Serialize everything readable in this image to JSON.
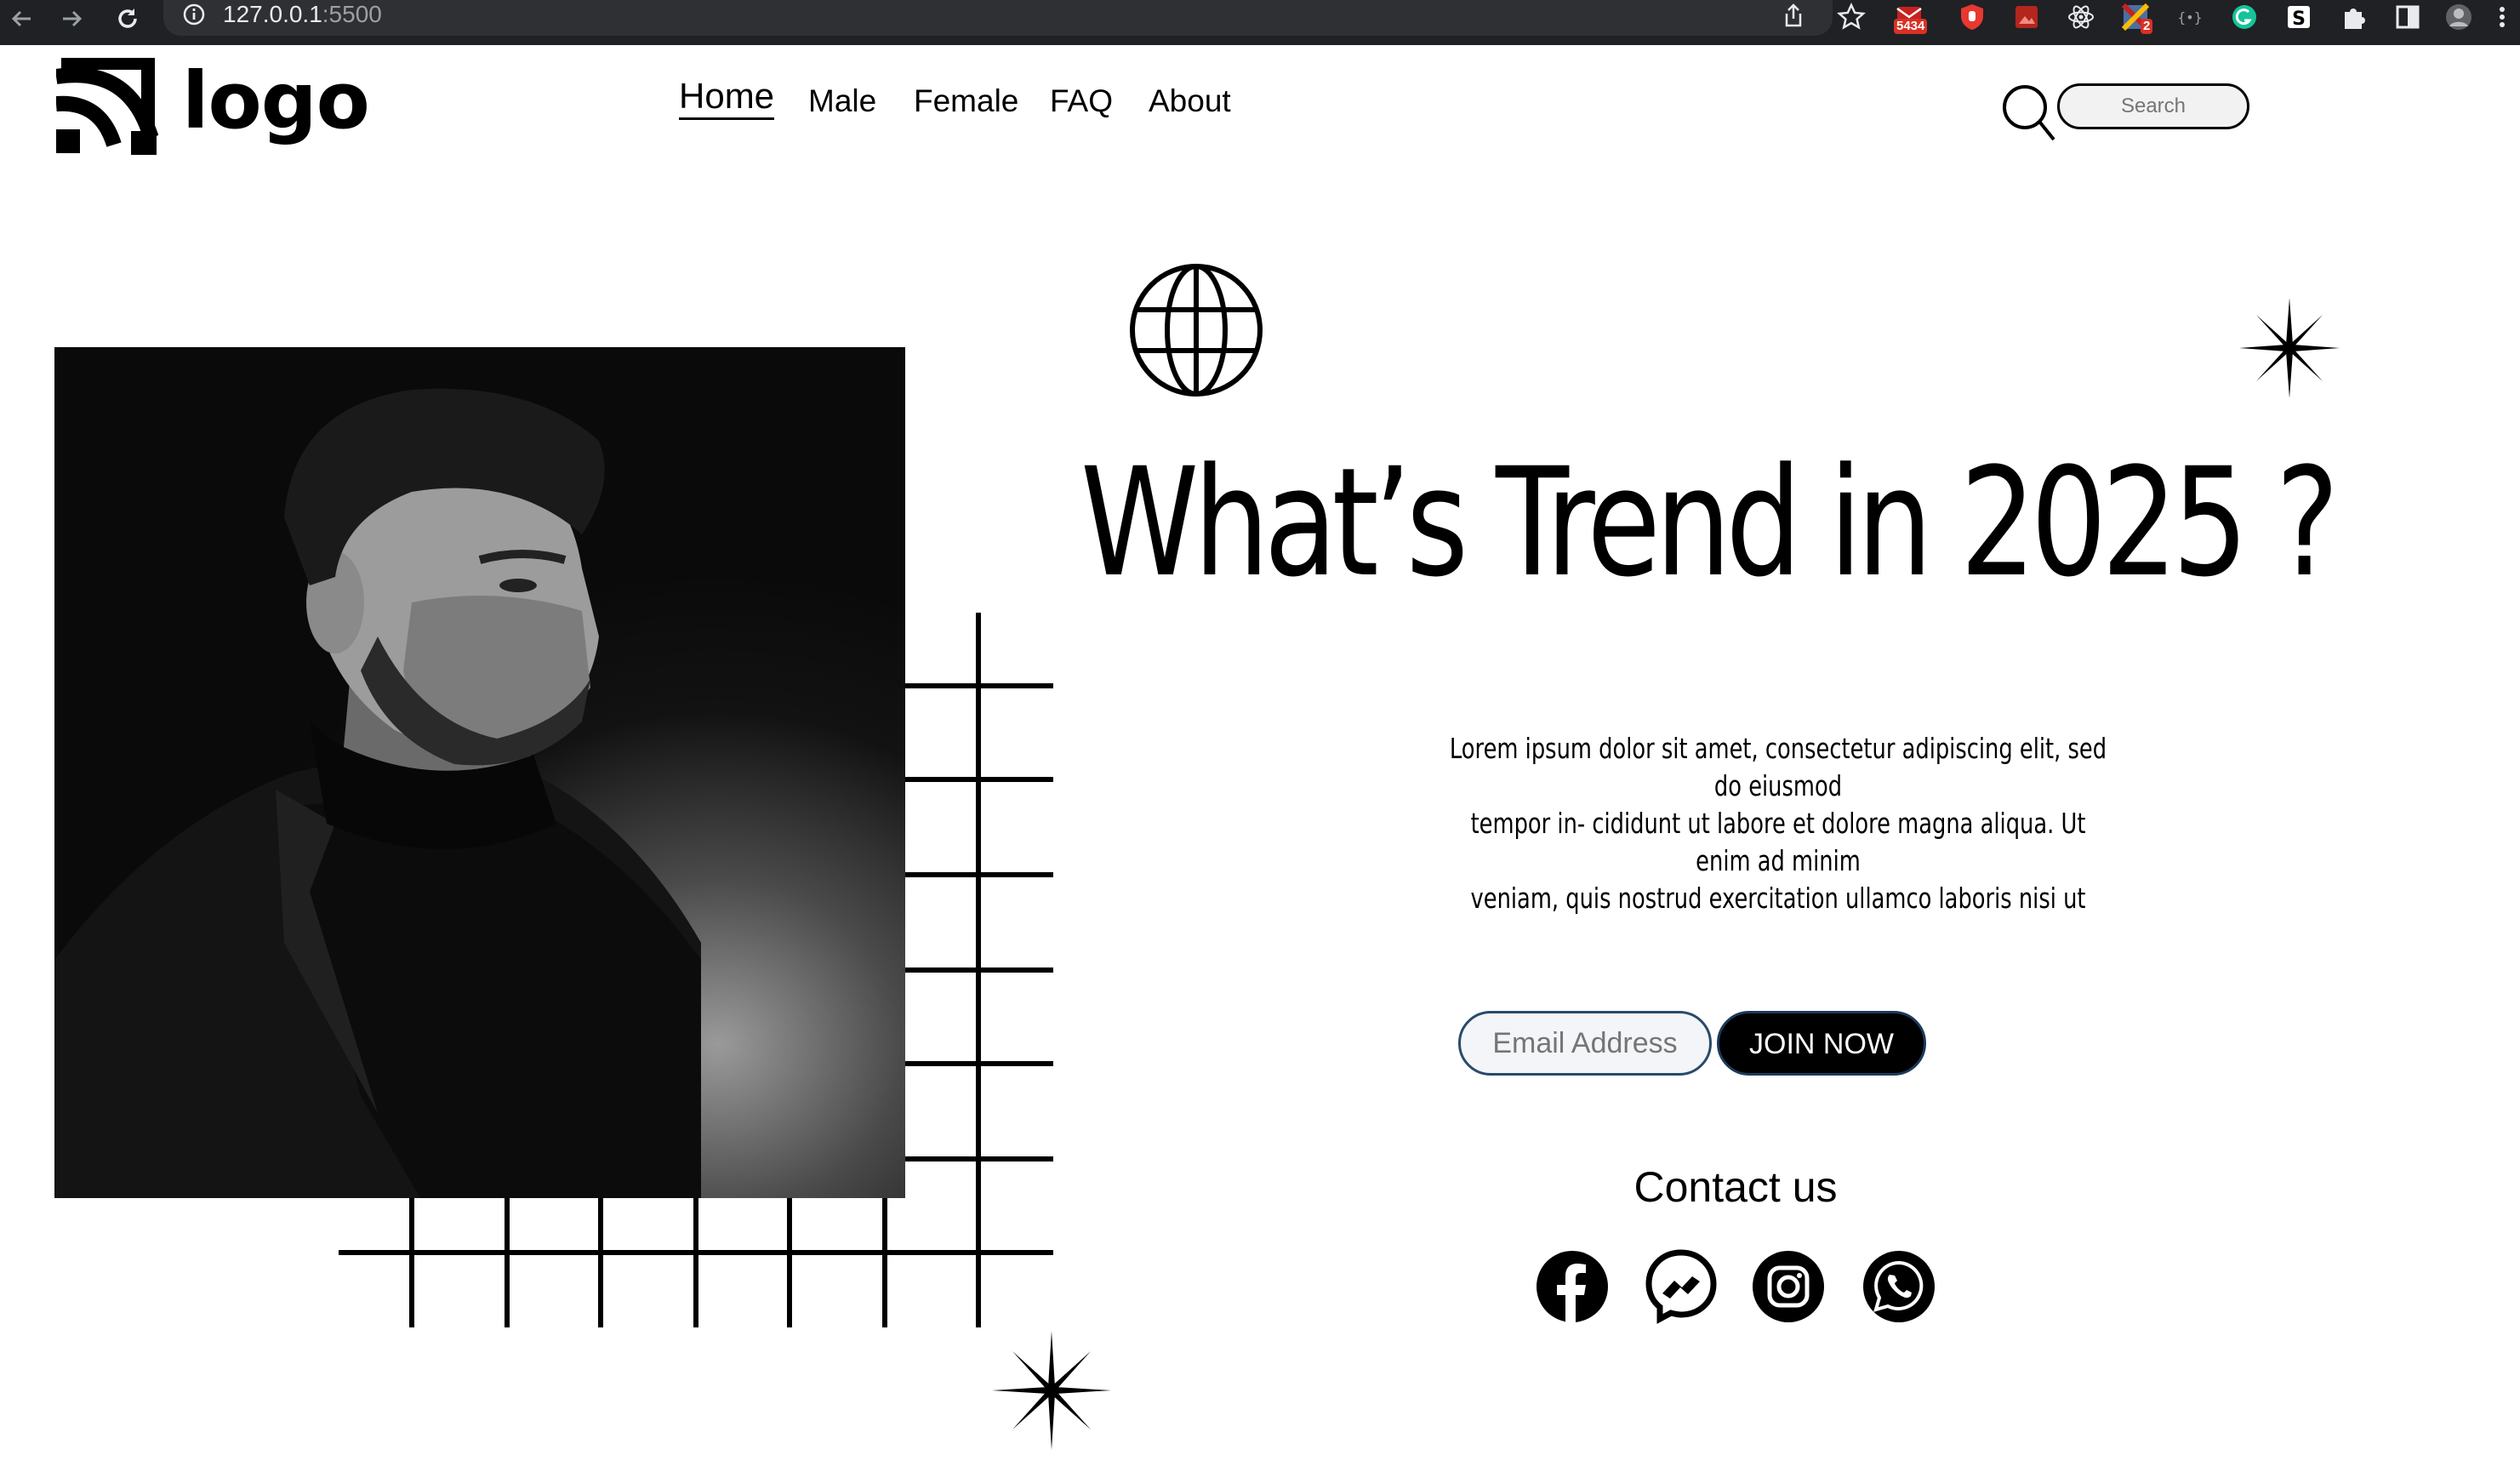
{
  "browser": {
    "url_host": "127.0.0.1",
    "url_port": ":5500",
    "extension_badges": [
      "5434",
      "2"
    ]
  },
  "site": {
    "logo_text": "logo",
    "nav": [
      {
        "label": "Home",
        "active": true
      },
      {
        "label": "Male",
        "active": false
      },
      {
        "label": "Female",
        "active": false
      },
      {
        "label": "FAQ",
        "active": false
      },
      {
        "label": "About",
        "active": false
      }
    ],
    "search_placeholder": "Search"
  },
  "hero": {
    "headline": "What’s Trend in 2025 ?",
    "body_lines": [
      "Lorem ipsum dolor sit amet, consectetur adipiscing elit, sed do eiusmod",
      "tempor in- cididunt ut labore et dolore magna aliqua. Ut enim ad minim",
      "veniam, quis nostrud exercitation ullamco laboris nisi ut"
    ],
    "email_placeholder": "Email Address",
    "join_label": "JOIN NOW",
    "contact_title": "Contact us",
    "socials": [
      "facebook-icon",
      "messenger-icon",
      "instagram-icon",
      "whatsapp-icon"
    ]
  },
  "colors": {
    "chrome_bg": "#202124",
    "omnibox_bg": "#2f3034",
    "page_bg": "#ffffff",
    "ink": "#000000",
    "email_border": "#2a4a6a"
  }
}
